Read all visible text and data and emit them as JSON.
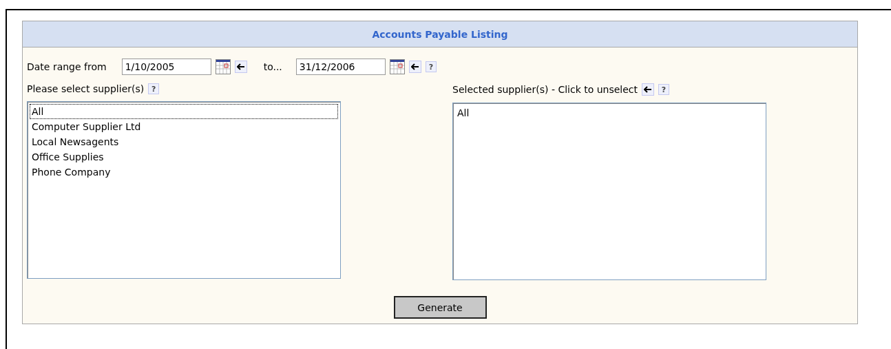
{
  "title": "Accounts Payable Listing",
  "date_range": {
    "from_label": "Date range from",
    "from_value": "1/10/2005",
    "to_label": "to...",
    "to_value": "31/12/2006",
    "help": "?"
  },
  "available": {
    "label": "Please select supplier(s)",
    "help": "?",
    "items": [
      {
        "text": "All",
        "focused": true
      },
      {
        "text": "Computer Supplier Ltd",
        "focused": false
      },
      {
        "text": "Local Newsagents",
        "focused": false
      },
      {
        "text": "Office Supplies",
        "focused": false
      },
      {
        "text": "Phone Company",
        "focused": false
      }
    ]
  },
  "selected": {
    "label": "Selected supplier(s) - Click to unselect",
    "help": "?",
    "items": [
      {
        "text": "All",
        "focused": false
      }
    ]
  },
  "button": "Generate"
}
